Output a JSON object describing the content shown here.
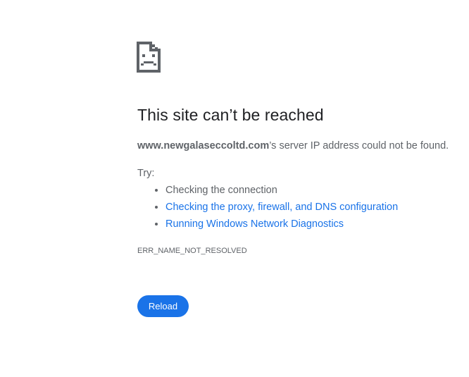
{
  "page": {
    "icon": "sad-page-icon",
    "title": "This site can’t be reached",
    "summary": {
      "host": "www.newgalaseccoltd.com",
      "message": "’s server IP address could not be found."
    },
    "try_label": "Try:",
    "suggestions": [
      {
        "text": "Checking the connection",
        "is_link": false
      },
      {
        "text": "Checking the proxy, firewall, and DNS configuration",
        "is_link": true
      },
      {
        "text": "Running Windows Network Diagnostics",
        "is_link": true
      }
    ],
    "error_code": "ERR_NAME_NOT_RESOLVED",
    "reload_label": "Reload",
    "colors": {
      "accent": "#1a73e8",
      "text": "#5f6368",
      "heading": "#202124"
    }
  }
}
